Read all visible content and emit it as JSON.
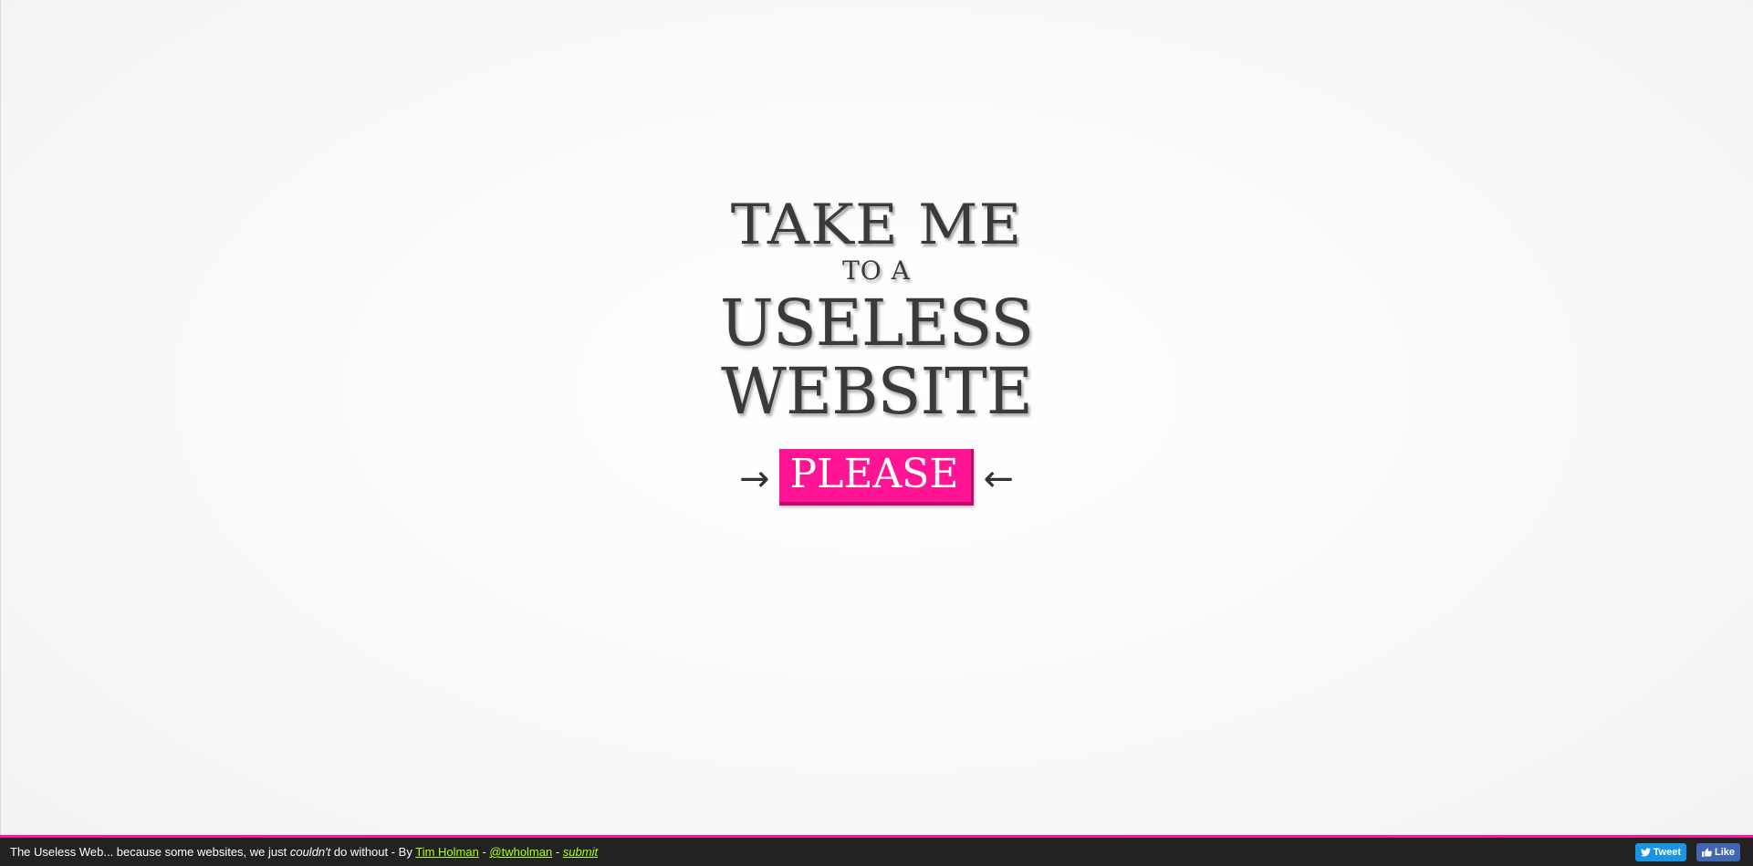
{
  "hero": {
    "line1": "TAKE ME",
    "line2": "TO A",
    "line3": "USELESS",
    "line4": "WEBSITE"
  },
  "cta": {
    "label": "PLEASE",
    "left_arrow": "→",
    "right_arrow": "←",
    "color": "#ff1493"
  },
  "footer": {
    "text_prefix": "The Useless Web... because some websites, we just ",
    "text_emphasis": "couldn't",
    "text_after": " do without - By ",
    "author_link": "Tim Holman",
    "sep1": " - ",
    "twitter_link": "@twholman",
    "sep2": " - ",
    "submit_link": "submit",
    "tweet_label": "Tweet",
    "like_label": "Like",
    "accent_color": "#ff1493",
    "link_color": "#b6ff00"
  }
}
